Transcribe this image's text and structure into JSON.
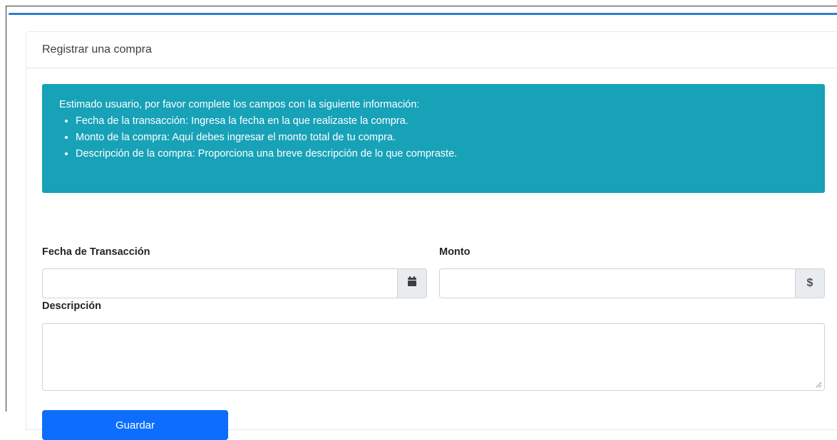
{
  "card": {
    "title": "Registrar una compra"
  },
  "alert": {
    "intro": "Estimado usuario, por favor complete los campos con la siguiente información:",
    "items": [
      "Fecha de la transacción: Ingresa la fecha en la que realizaste la compra.",
      "Monto de la compra: Aquí debes ingresar el monto total de tu compra.",
      "Descripción de la compra: Proporciona una breve descripción de lo que compraste."
    ]
  },
  "form": {
    "fecha_label": "Fecha de Transacción",
    "fecha_value": "",
    "fecha_icon": "calendar-icon",
    "monto_label": "Monto",
    "monto_value": "",
    "monto_addon": "$",
    "descripcion_label": "Descripción",
    "descripcion_value": "",
    "save_label": "Guardar"
  },
  "colors": {
    "accent_strip": "#2f7ad8",
    "alert_bg": "#17a2b8",
    "primary_button": "#0d6efd",
    "addon_bg": "#e9ecef"
  }
}
